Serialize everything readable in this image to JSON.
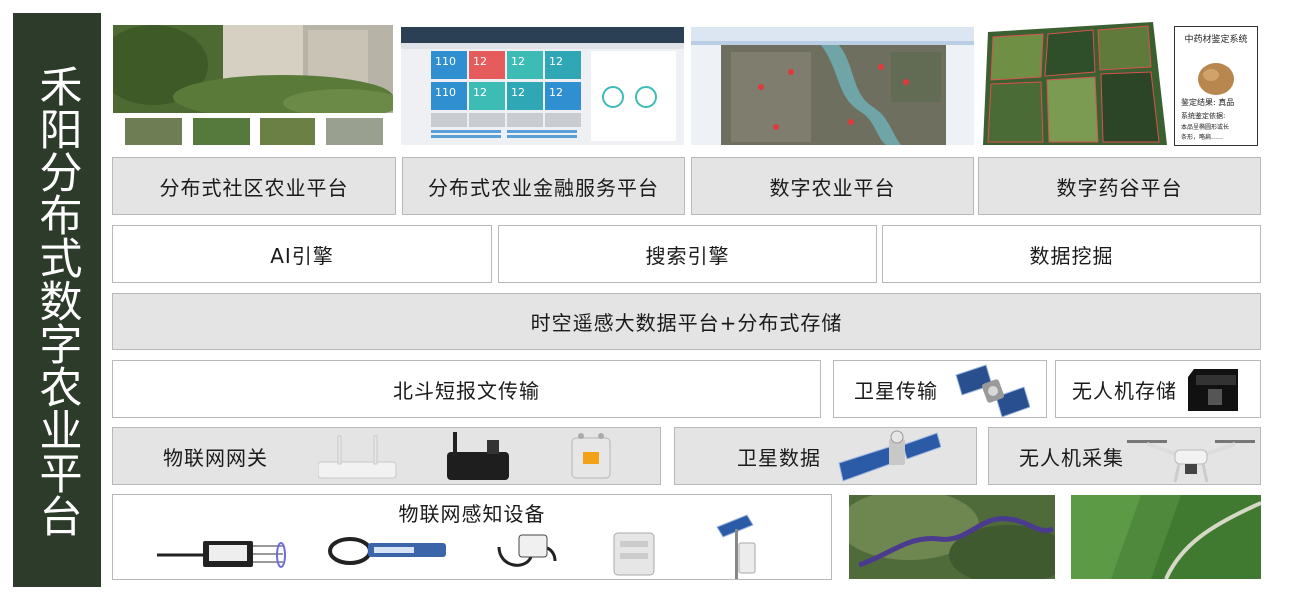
{
  "sidebar": {
    "title": "禾阳分布式数字农业平台"
  },
  "platforms": [
    {
      "label": "分布式社区农业平台"
    },
    {
      "label": "分布式农业金融服务平台"
    },
    {
      "label": "数字农业平台"
    },
    {
      "label": "数字药谷平台"
    }
  ],
  "engines": [
    {
      "label": "AI引擎"
    },
    {
      "label": "搜索引擎"
    },
    {
      "label": "数据挖掘"
    }
  ],
  "bigdata": {
    "label": "时空遥感大数据平台+分布式存储"
  },
  "transport": {
    "beidou": "北斗短报文传输",
    "satellite": "卫星传输",
    "uav_storage": "无人机存储"
  },
  "acquisition": {
    "iot_gateway": "物联网网关",
    "satellite_data": "卫星数据",
    "uav_collect": "无人机采集"
  },
  "sensors": {
    "label": "物联网感知设备"
  },
  "dashboard_thumb": {
    "tiles": [
      "110",
      "12",
      "12",
      "12",
      "110",
      "12",
      "12",
      "12"
    ]
  },
  "herb_thumb": {
    "title": "中药材鉴定系统",
    "result": "鉴定结果: 真品",
    "detail_1": "系统鉴定依据:",
    "detail_2": "本品呈椭圆形或长",
    "detail_3": "条形，略扁……"
  },
  "colors": {
    "sidebar": "#2c3b2a",
    "box_gray": "#e4e4e4",
    "border": "#b9b9b9"
  }
}
